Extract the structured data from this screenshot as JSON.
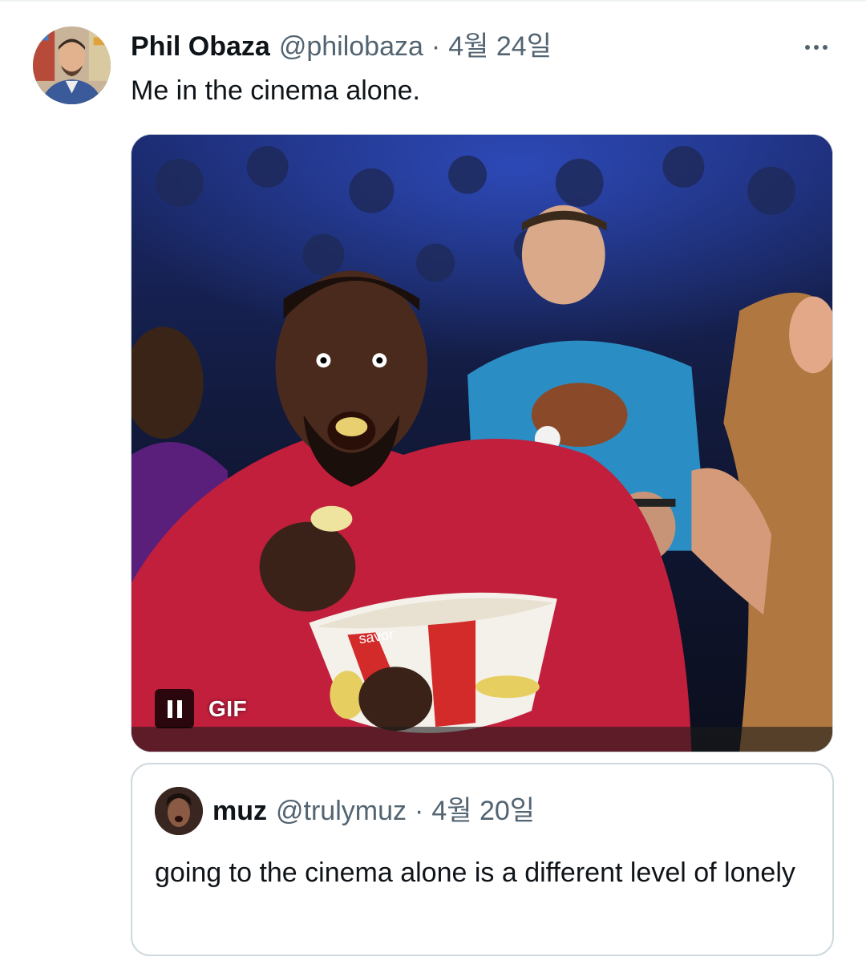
{
  "tweet": {
    "author_name": "Phil Obaza",
    "author_handle": "@philobaza",
    "separator": "·",
    "date": "4월 24일",
    "text": "Me in the cinema alone.",
    "more_icon": "more-horizontal-icon"
  },
  "media": {
    "type": "GIF",
    "badge": "GIF",
    "pause_icon": "pause-icon",
    "cup_print": "savor"
  },
  "quoted_tweet": {
    "author_name": "muz",
    "author_handle": "@trulymuz",
    "separator": "·",
    "date": "4월 20일",
    "text": "going to the cinema alone is a different level of lonely"
  },
  "colors": {
    "text_primary": "#0f1419",
    "text_secondary": "#536471",
    "border": "#cfd9de"
  }
}
